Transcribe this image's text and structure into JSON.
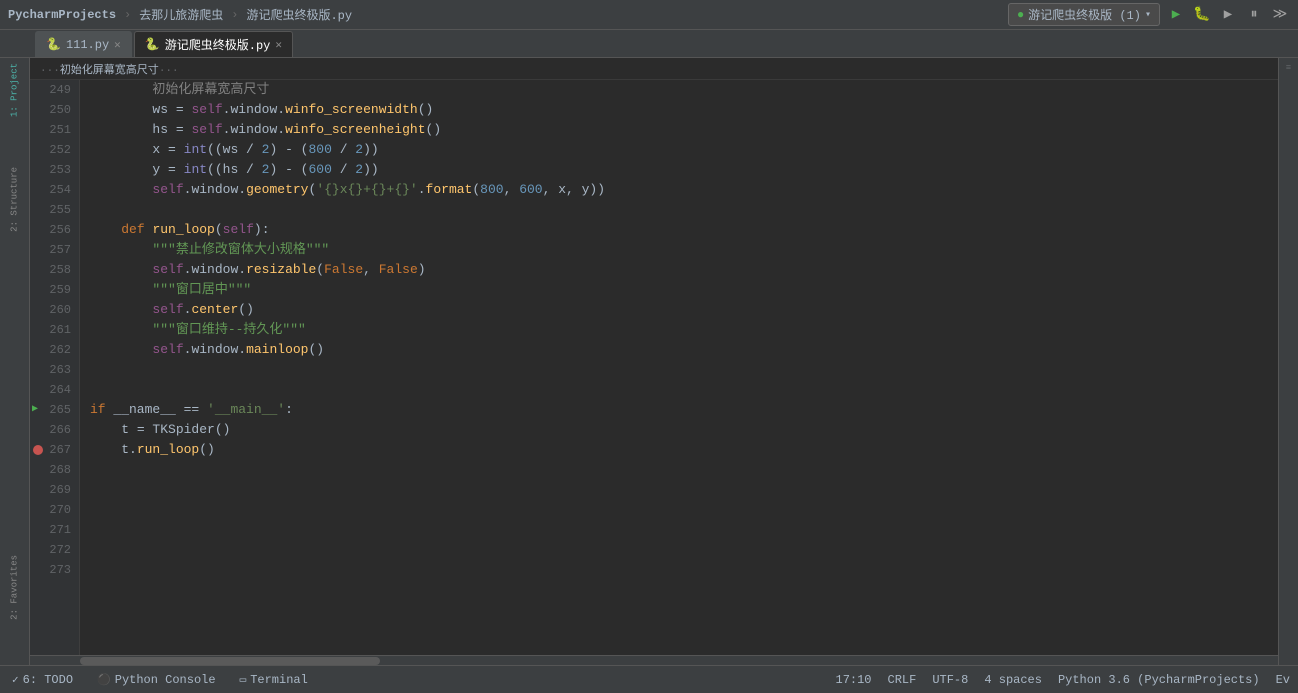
{
  "titlebar": {
    "project": "PycharmProjects",
    "breadcrumb1": "去那儿旅游爬虫",
    "file": "游记爬虫终极版.py",
    "run_config": "游记爬虫终极版 (1)",
    "run_config_chevron": "▾"
  },
  "tabs": [
    {
      "id": "111py",
      "label": "111.py",
      "icon": "🐍",
      "active": false
    },
    {
      "id": "spider",
      "label": "游记爬虫终极版.py",
      "icon": "🐍",
      "active": true
    }
  ],
  "breadcrumb": {
    "text": "...  初始化屏幕宽高尺寸  ..."
  },
  "lines": [
    {
      "num": 249,
      "breakpoint": false,
      "arrow": false,
      "content": "        <comment>初始化屏幕宽高尺寸</comment>"
    },
    {
      "num": 250,
      "breakpoint": false,
      "arrow": false,
      "content": "ws_assign"
    },
    {
      "num": 251,
      "breakpoint": false,
      "arrow": false,
      "content": "hs_assign"
    },
    {
      "num": 252,
      "breakpoint": false,
      "arrow": false,
      "content": "x_assign"
    },
    {
      "num": 253,
      "breakpoint": false,
      "arrow": false,
      "content": "y_assign"
    },
    {
      "num": 254,
      "breakpoint": false,
      "arrow": false,
      "content": "geometry_call"
    },
    {
      "num": 255,
      "breakpoint": false,
      "arrow": false,
      "content": ""
    },
    {
      "num": 256,
      "breakpoint": false,
      "arrow": false,
      "content": "def_run_loop"
    },
    {
      "num": 257,
      "breakpoint": false,
      "arrow": false,
      "content": "doc_jinzhi"
    },
    {
      "num": 258,
      "breakpoint": false,
      "arrow": false,
      "content": "resizable_call"
    },
    {
      "num": 259,
      "breakpoint": false,
      "arrow": false,
      "content": "doc_juzhong"
    },
    {
      "num": 260,
      "breakpoint": false,
      "arrow": false,
      "content": "center_call"
    },
    {
      "num": 261,
      "breakpoint": false,
      "arrow": false,
      "content": "doc_chijiuhua"
    },
    {
      "num": 262,
      "breakpoint": false,
      "arrow": false,
      "content": "mainloop_call"
    },
    {
      "num": 263,
      "breakpoint": false,
      "arrow": false,
      "content": ""
    },
    {
      "num": 264,
      "breakpoint": false,
      "arrow": false,
      "content": ""
    },
    {
      "num": 265,
      "breakpoint": false,
      "arrow": true,
      "content": "if_main"
    },
    {
      "num": 266,
      "breakpoint": false,
      "arrow": false,
      "content": "t_assign"
    },
    {
      "num": 267,
      "breakpoint": true,
      "arrow": false,
      "content": "t_run"
    },
    {
      "num": 268,
      "breakpoint": false,
      "arrow": false,
      "content": ""
    },
    {
      "num": 269,
      "breakpoint": false,
      "arrow": false,
      "content": ""
    },
    {
      "num": 270,
      "breakpoint": false,
      "arrow": false,
      "content": ""
    },
    {
      "num": 271,
      "breakpoint": false,
      "arrow": false,
      "content": ""
    },
    {
      "num": 272,
      "breakpoint": false,
      "arrow": false,
      "content": ""
    },
    {
      "num": 273,
      "breakpoint": false,
      "arrow": false,
      "content": ""
    }
  ],
  "bottom": {
    "todo_label": "6: TODO",
    "console_label": "Python Console",
    "terminal_label": "Terminal",
    "position": "17:10",
    "line_sep": "CRLF",
    "encoding": "UTF-8",
    "indent": "4 spaces",
    "python_version": "Python 3.6 (PycharmProjects)",
    "ev_label": "Ev"
  },
  "sidebar_labels": {
    "project": "1: Project",
    "structure": "2: Structure",
    "favorites": "2: Favorites"
  }
}
